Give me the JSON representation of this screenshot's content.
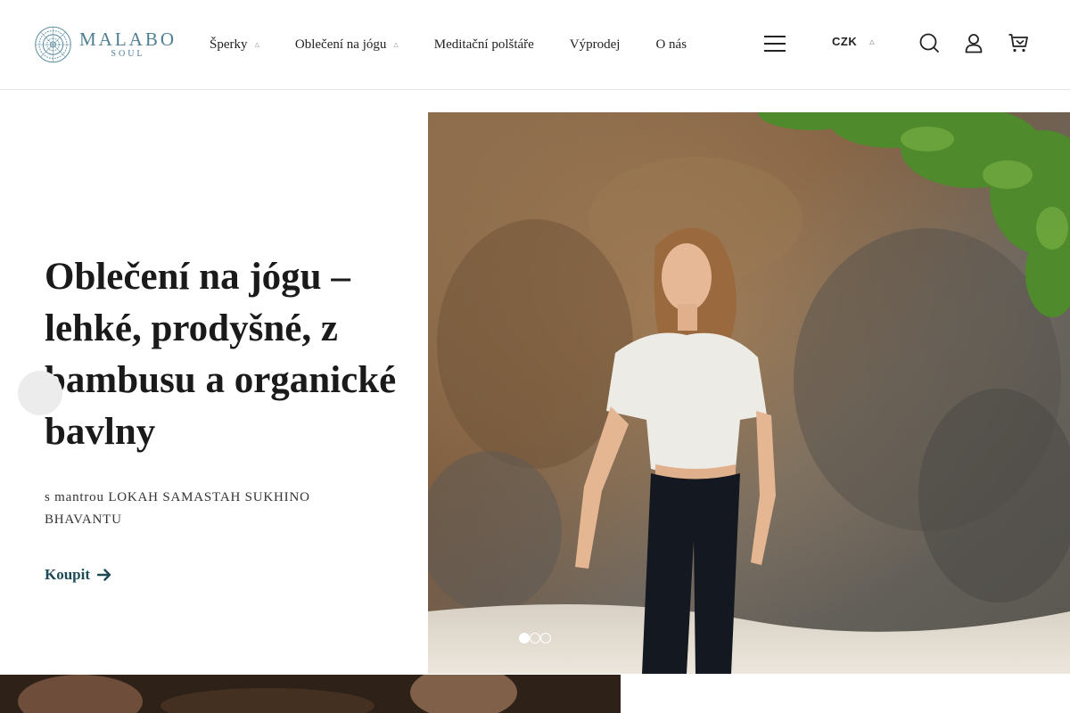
{
  "header": {
    "logo": {
      "name": "MALABO",
      "sub": "SOUL",
      "color": "#4f7f93",
      "icon": "mandala-logo-icon"
    },
    "nav": [
      {
        "label": "Šperky",
        "has_dropdown": true
      },
      {
        "label": "Oblečení na jógu",
        "has_dropdown": true
      },
      {
        "label": "Meditační polštáře",
        "has_dropdown": false
      },
      {
        "label": "Výprodej",
        "has_dropdown": false
      },
      {
        "label": "O nás",
        "has_dropdown": false
      }
    ],
    "currency": "CZK",
    "icons": [
      "hamburger-menu-icon",
      "search-icon",
      "user-icon",
      "cart-icon"
    ]
  },
  "hero": {
    "title": "Oblečení na jógu – lehké, prodyšné, z bambusu a organické bavlny",
    "subtitle": "s mantrou LOKAH SAMASTAH SUKHINO BHAVANTU",
    "cta": "Koupit",
    "cta_color": "#1e4b55",
    "slides_total": 3,
    "active_slide": 1
  }
}
